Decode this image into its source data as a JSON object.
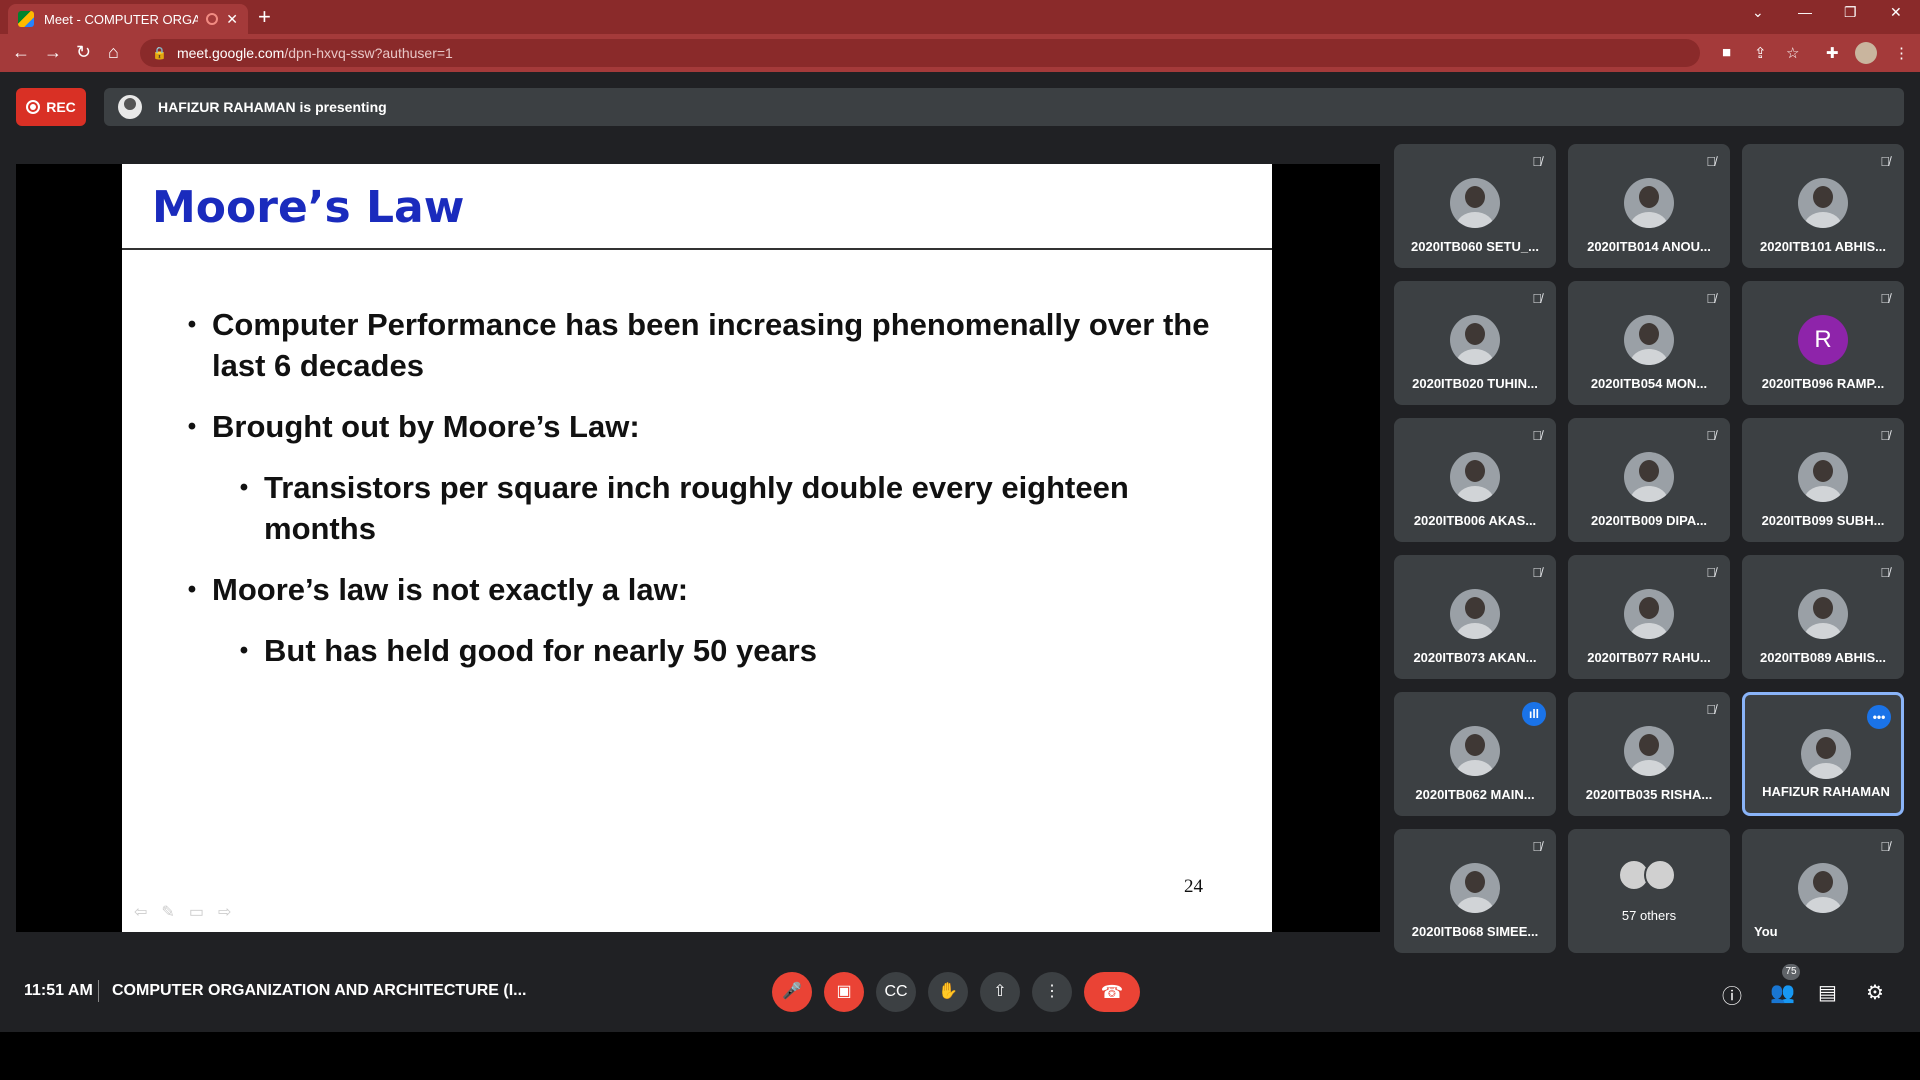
{
  "browser": {
    "tab_title": "Meet - COMPUTER ORGANIZ",
    "tab_close": "✕",
    "new_tab": "+",
    "url_host": "meet.google.com",
    "url_path": "/dpn-hxvq-ssw?authuser=1",
    "icons": [
      "back-icon",
      "forward-icon",
      "reload-icon",
      "home-icon",
      "lock-icon",
      "camera-icon",
      "share-icon",
      "star-icon",
      "extensions-icon",
      "menu-icon"
    ]
  },
  "meet": {
    "rec_label": "REC",
    "presenting_text": "HAFIZUR RAHAMAN is presenting",
    "slide": {
      "title": "Moore’s Law",
      "bullets": [
        "Computer Performance has been increasing phenomenally over the last 6 decades",
        "Brought out by Moore’s Law:",
        "Transistors per square inch roughly double every eighteen months",
        "Moore’s law is not exactly a law:",
        "But has held good for nearly 50 years"
      ],
      "page_number": "24"
    },
    "participants": [
      "2020ITB060 SETU_...",
      "2020ITB014 ANOU...",
      "2020ITB101 ABHIS...",
      "2020ITB020 TUHIN...",
      "2020ITB054 MON...",
      "2020ITB096 RAMP...",
      "2020ITB006 AKAS...",
      "2020ITB009 DIPA...",
      "2020ITB099 SUBH...",
      "2020ITB073 AKAN...",
      "2020ITB077 RAHU...",
      "2020ITB089 ABHIS...",
      "2020ITB062 MAIN...",
      "2020ITB035 RISHA...",
      "HAFIZUR RAHAMAN",
      "2020ITB068 SIMEE...",
      "57 others",
      "You"
    ],
    "letter_avatar": "R",
    "time": "11:51 AM",
    "meeting_name": "COMPUTER ORGANIZATION AND ARCHITECTURE (I...",
    "people_count": "75",
    "accent": "#8ab4f8",
    "danger": "#ea4335"
  }
}
